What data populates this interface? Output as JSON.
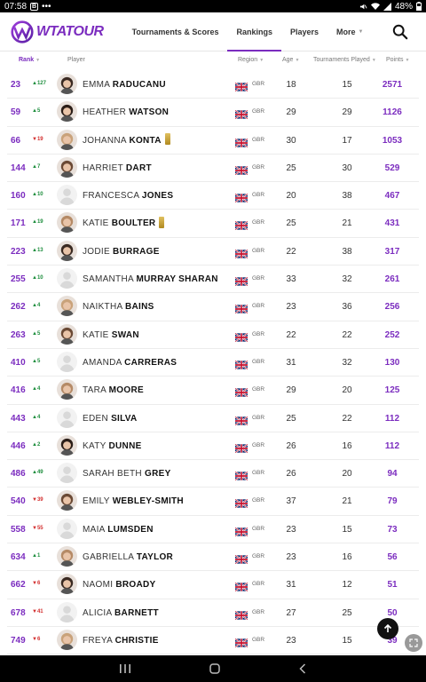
{
  "status_bar": {
    "time": "07:58",
    "app_badge": "B",
    "dots": "•••",
    "battery": "48%"
  },
  "header": {
    "logo_text": "WTATOUR",
    "nav": [
      {
        "label": "Tournaments & Scores",
        "active": false,
        "has_chevron": false
      },
      {
        "label": "Rankings",
        "active": true,
        "has_chevron": false
      },
      {
        "label": "Players",
        "active": false,
        "has_chevron": false
      },
      {
        "label": "More",
        "active": false,
        "has_chevron": true
      }
    ]
  },
  "columns": {
    "rank": "Rank",
    "player": "Player",
    "region": "Region",
    "age": "Age",
    "played": "Tournaments Played",
    "points": "Points"
  },
  "rows": [
    {
      "rank": "23",
      "move": "127",
      "dir": "up",
      "first": "EMMA",
      "last": "RADUCANU",
      "badge": false,
      "country": "GBR",
      "age": "18",
      "played": "15",
      "points": "2571",
      "avatar": "photo"
    },
    {
      "rank": "59",
      "move": "5",
      "dir": "up",
      "first": "HEATHER",
      "last": "WATSON",
      "badge": false,
      "country": "GBR",
      "age": "29",
      "played": "29",
      "points": "1126",
      "avatar": "photo"
    },
    {
      "rank": "66",
      "move": "19",
      "dir": "down",
      "first": "JOHANNA",
      "last": "KONTA",
      "badge": true,
      "country": "GBR",
      "age": "30",
      "played": "17",
      "points": "1053",
      "avatar": "photo"
    },
    {
      "rank": "144",
      "move": "7",
      "dir": "up",
      "first": "HARRIET",
      "last": "DART",
      "badge": false,
      "country": "GBR",
      "age": "25",
      "played": "30",
      "points": "529",
      "avatar": "photo"
    },
    {
      "rank": "160",
      "move": "10",
      "dir": "up",
      "first": "FRANCESCA",
      "last": "JONES",
      "badge": false,
      "country": "GBR",
      "age": "20",
      "played": "38",
      "points": "467",
      "avatar": "silhouette"
    },
    {
      "rank": "171",
      "move": "19",
      "dir": "up",
      "first": "KATIE",
      "last": "BOULTER",
      "badge": true,
      "country": "GBR",
      "age": "25",
      "played": "21",
      "points": "431",
      "avatar": "photo"
    },
    {
      "rank": "223",
      "move": "13",
      "dir": "up",
      "first": "JODIE",
      "last": "BURRAGE",
      "badge": false,
      "country": "GBR",
      "age": "22",
      "played": "38",
      "points": "317",
      "avatar": "photo"
    },
    {
      "rank": "255",
      "move": "10",
      "dir": "up",
      "first": "SAMANTHA",
      "last": "MURRAY SHARAN",
      "badge": false,
      "country": "GBR",
      "age": "33",
      "played": "32",
      "points": "261",
      "avatar": "silhouette"
    },
    {
      "rank": "262",
      "move": "4",
      "dir": "up",
      "first": "NAIKTHA",
      "last": "BAINS",
      "badge": false,
      "country": "GBR",
      "age": "23",
      "played": "36",
      "points": "256",
      "avatar": "photo"
    },
    {
      "rank": "263",
      "move": "5",
      "dir": "up",
      "first": "KATIE",
      "last": "SWAN",
      "badge": false,
      "country": "GBR",
      "age": "22",
      "played": "22",
      "points": "252",
      "avatar": "photo"
    },
    {
      "rank": "410",
      "move": "5",
      "dir": "up",
      "first": "AMANDA",
      "last": "CARRERAS",
      "badge": false,
      "country": "GBR",
      "age": "31",
      "played": "32",
      "points": "130",
      "avatar": "silhouette"
    },
    {
      "rank": "416",
      "move": "4",
      "dir": "up",
      "first": "TARA",
      "last": "MOORE",
      "badge": false,
      "country": "GBR",
      "age": "29",
      "played": "20",
      "points": "125",
      "avatar": "photo"
    },
    {
      "rank": "443",
      "move": "4",
      "dir": "up",
      "first": "EDEN",
      "last": "SILVA",
      "badge": false,
      "country": "GBR",
      "age": "25",
      "played": "22",
      "points": "112",
      "avatar": "silhouette"
    },
    {
      "rank": "446",
      "move": "2",
      "dir": "up",
      "first": "KATY",
      "last": "DUNNE",
      "badge": false,
      "country": "GBR",
      "age": "26",
      "played": "16",
      "points": "112",
      "avatar": "photo"
    },
    {
      "rank": "486",
      "move": "49",
      "dir": "up",
      "first": "SARAH BETH",
      "last": "GREY",
      "badge": false,
      "country": "GBR",
      "age": "26",
      "played": "20",
      "points": "94",
      "avatar": "silhouette"
    },
    {
      "rank": "540",
      "move": "39",
      "dir": "down",
      "first": "EMILY",
      "last": "WEBLEY-SMITH",
      "badge": false,
      "country": "GBR",
      "age": "37",
      "played": "21",
      "points": "79",
      "avatar": "photo"
    },
    {
      "rank": "558",
      "move": "55",
      "dir": "down",
      "first": "MAIA",
      "last": "LUMSDEN",
      "badge": false,
      "country": "GBR",
      "age": "23",
      "played": "15",
      "points": "73",
      "avatar": "silhouette"
    },
    {
      "rank": "634",
      "move": "1",
      "dir": "up",
      "first": "GABRIELLA",
      "last": "TAYLOR",
      "badge": false,
      "country": "GBR",
      "age": "23",
      "played": "16",
      "points": "56",
      "avatar": "photo"
    },
    {
      "rank": "662",
      "move": "6",
      "dir": "down",
      "first": "NAOMI",
      "last": "BROADY",
      "badge": false,
      "country": "GBR",
      "age": "31",
      "played": "12",
      "points": "51",
      "avatar": "photo"
    },
    {
      "rank": "678",
      "move": "41",
      "dir": "down",
      "first": "ALICIA",
      "last": "BARNETT",
      "badge": false,
      "country": "GBR",
      "age": "27",
      "played": "25",
      "points": "50",
      "avatar": "silhouette"
    },
    {
      "rank": "749",
      "move": "6",
      "dir": "down",
      "first": "FREYA",
      "last": "CHRISTIE",
      "badge": false,
      "country": "GBR",
      "age": "23",
      "played": "15",
      "points": "39",
      "avatar": "photo"
    }
  ],
  "colors": {
    "accent": "#7b2cbf",
    "up": "#1e8e3e",
    "down": "#d32f2f"
  }
}
